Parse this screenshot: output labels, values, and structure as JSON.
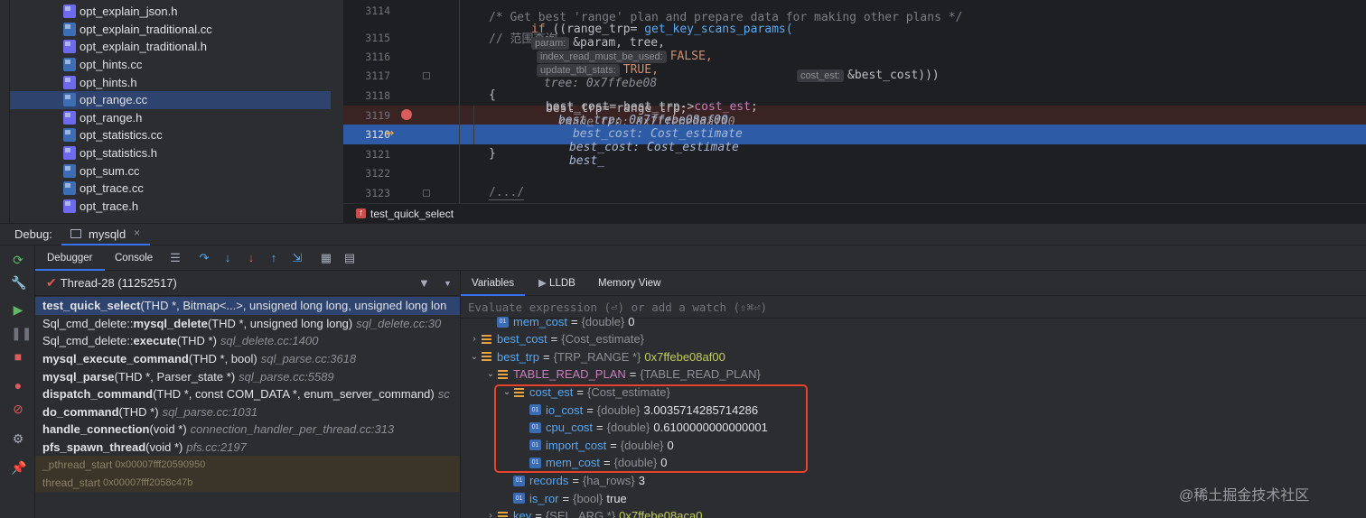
{
  "tree": {
    "files": [
      {
        "name": "opt_explain_json.h",
        "kind": "h"
      },
      {
        "name": "opt_explain_traditional.cc",
        "kind": "cc"
      },
      {
        "name": "opt_explain_traditional.h",
        "kind": "h"
      },
      {
        "name": "opt_hints.cc",
        "kind": "cc"
      },
      {
        "name": "opt_hints.h",
        "kind": "h"
      },
      {
        "name": "opt_range.cc",
        "kind": "cc",
        "selected": true
      },
      {
        "name": "opt_range.h",
        "kind": "h"
      },
      {
        "name": "opt_statistics.cc",
        "kind": "cc"
      },
      {
        "name": "opt_statistics.h",
        "kind": "h"
      },
      {
        "name": "opt_sum.cc",
        "kind": "cc"
      },
      {
        "name": "opt_trace.cc",
        "kind": "cc"
      },
      {
        "name": "opt_trace.h",
        "kind": "h"
      }
    ]
  },
  "editor": {
    "line_numbers": [
      "3114",
      "3115",
      "3116",
      "3117",
      "3118",
      "3119",
      "3120",
      "3121",
      "3122",
      "3123"
    ],
    "comment1": "/* Get best 'range' plan and prepare data for making other plans */",
    "comment2": "// 范围查询",
    "kw_if": "if",
    "open_paren": " ((range_trp= ",
    "fn_get": "get_key_scans_params(",
    "hint_param": "param:",
    "arg_param": "&param, tree,",
    "hint_index": "index_read_must_be_used:",
    "arg_false": "FALSE,",
    "hint_update": "update_tbl_stats:",
    "arg_true": "TRUE,",
    "inline_tree": "tree: 0x7ffebe08",
    "hint_cost_est": "cost_est:",
    "arg_best_cost": "&best_cost)))",
    "brace_open": "{",
    "line3119_code": "best_trp= range_trp;",
    "line3119_inline": "range_trp: 0x7ffebe08af00",
    "line3120_code_a": "best_cost= best_trp->",
    "line3120_field": "cost_est",
    "line3120_semi": ";",
    "line3120_inline1": "best_trp: 0x7ffebe08af00",
    "line3120_inline2": "best_cost: Cost_estimate",
    "line3120_inline3": "best_cost: Cost_estimate",
    "line3120_inline4": "best_",
    "brace_close": "}",
    "line3123": "/.../",
    "breadcrumb": "test_quick_select"
  },
  "debug": {
    "title": "Debug:",
    "session_tab": "mysqld",
    "tab_debugger": "Debugger",
    "tab_console": "Console",
    "thread_label": "Thread-28 (11252517)",
    "frames": [
      {
        "fn": "test_quick_select",
        "args": "(THD *, Bitmap<...>, unsigned long long, unsigned long lon",
        "loc": "",
        "selected": true
      },
      {
        "prefix": "Sql_cmd_delete::",
        "fn": "mysql_delete",
        "args": "(THD *, unsigned long long)",
        "loc": "sql_delete.cc:30"
      },
      {
        "prefix": "Sql_cmd_delete::",
        "fn": "execute",
        "args": "(THD *)",
        "loc": "sql_delete.cc:1400"
      },
      {
        "prefix": "",
        "fn": "mysql_execute_command",
        "args": "(THD *, bool)",
        "loc": "sql_parse.cc:3618"
      },
      {
        "prefix": "",
        "fn": "mysql_parse",
        "args": "(THD *, Parser_state *)",
        "loc": "sql_parse.cc:5589"
      },
      {
        "prefix": "",
        "fn": "dispatch_command",
        "args": "(THD *, const COM_DATA *, enum_server_command)",
        "loc": "sc"
      },
      {
        "prefix": "",
        "fn": "do_command",
        "args": "(THD *)",
        "loc": "sql_parse.cc:1031"
      },
      {
        "prefix": "",
        "fn": "handle_connection",
        "args": "(void *)",
        "loc": "connection_handler_per_thread.cc:313"
      },
      {
        "prefix": "",
        "fn": "pfs_spawn_thread",
        "args": "(void *)",
        "loc": "pfs.cc:2197"
      }
    ],
    "lib_frames": [
      {
        "fn": "_pthread_start",
        "addr": "0x00007fff20590950"
      },
      {
        "fn": "thread_start",
        "addr": "0x00007fff2058c47b"
      }
    ],
    "vars_tab_variables": "Variables",
    "vars_tab_lldb": "LLDB",
    "vars_tab_memory": "Memory View",
    "eval_placeholder": "Evaluate expression (⏎) or add a watch (⇧⌘⏎)",
    "variables": [
      {
        "level": 1,
        "arrow": "",
        "icon": "prim",
        "name": "mem_cost",
        "type": "{double}",
        "value": "0",
        "partial": true
      },
      {
        "level": 0,
        "arrow": "›",
        "icon": "obj",
        "name": "best_cost",
        "type": "{Cost_estimate}",
        "value": ""
      },
      {
        "level": 0,
        "arrow": "⌄",
        "icon": "obj",
        "name": "best_trp",
        "type": "{TRP_RANGE *}",
        "value": "0x7ffebe08af00",
        "addr": true
      },
      {
        "level": 1,
        "arrow": "⌄",
        "icon": "obj",
        "name": "TABLE_READ_PLAN",
        "type": "{TABLE_READ_PLAN}",
        "value": "",
        "expand": true
      },
      {
        "level": 2,
        "arrow": "⌄",
        "icon": "obj",
        "name": "cost_est",
        "type": "{Cost_estimate}",
        "value": ""
      },
      {
        "level": 3,
        "arrow": "",
        "icon": "prim",
        "name": "io_cost",
        "type": "{double}",
        "value": "3.0035714285714286"
      },
      {
        "level": 3,
        "arrow": "",
        "icon": "prim",
        "name": "cpu_cost",
        "type": "{double}",
        "value": "0.6100000000000001"
      },
      {
        "level": 3,
        "arrow": "",
        "icon": "prim",
        "name": "import_cost",
        "type": "{double}",
        "value": "0"
      },
      {
        "level": 3,
        "arrow": "",
        "icon": "prim",
        "name": "mem_cost",
        "type": "{double}",
        "value": "0"
      },
      {
        "level": 2,
        "arrow": "",
        "icon": "prim",
        "name": "records",
        "type": "{ha_rows}",
        "value": "3"
      },
      {
        "level": 2,
        "arrow": "",
        "icon": "prim",
        "name": "is_ror",
        "type": "{bool}",
        "value": "true"
      },
      {
        "level": 1,
        "arrow": "›",
        "icon": "obj",
        "name": "key",
        "type": "{SEL_ARG *}",
        "value": "0x7ffebe08aca0",
        "addr": true
      }
    ]
  },
  "watermark": "@稀土掘金技术社区",
  "colors": {
    "accent": "#3574f0",
    "current_line": "#2d5ba6",
    "highlight_box": "#e8412c"
  }
}
